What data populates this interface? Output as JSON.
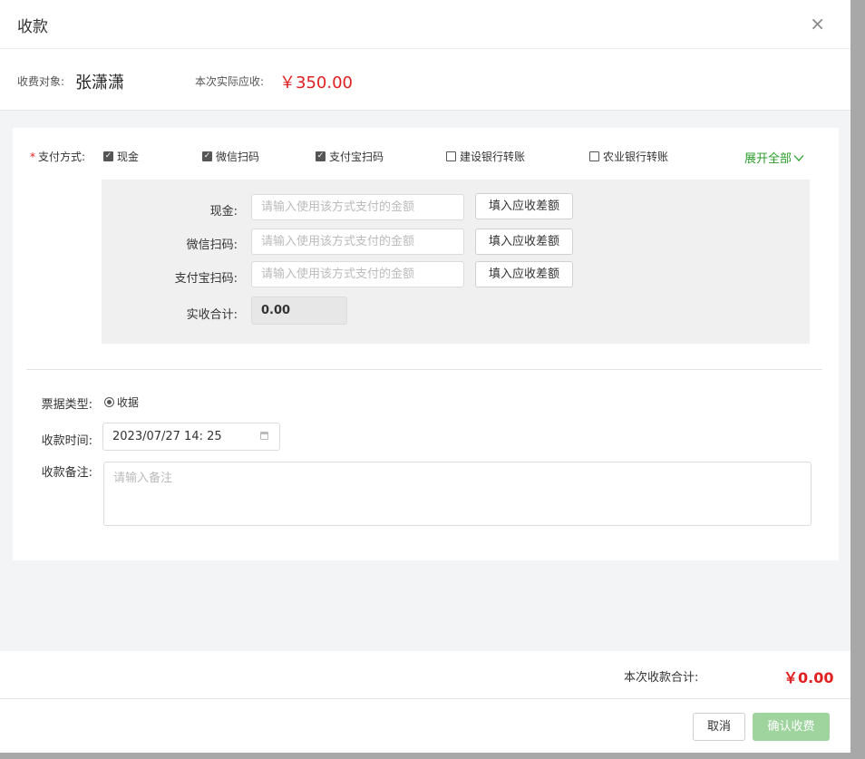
{
  "dialog": {
    "title": "收款",
    "close_glyph": "×"
  },
  "info": {
    "payer_label": "收费对象:",
    "payer_name": "张潇潇",
    "due_label": "本次实际应收:",
    "due_amount": "￥350.00"
  },
  "payment": {
    "label": "支付方式:",
    "required_mark": "*",
    "methods": [
      {
        "label": "现金",
        "checked": true
      },
      {
        "label": "微信扫码",
        "checked": true
      },
      {
        "label": "支付宝扫码",
        "checked": true
      },
      {
        "label": "建设银行转账",
        "checked": false
      },
      {
        "label": "农业银行转账",
        "checked": false
      }
    ],
    "expand_label": "展开全部",
    "expand_icon": "chevron-down-icon",
    "rows": [
      {
        "label": "现金:",
        "placeholder": "请输入使用该方式支付的金额",
        "fill_button": "填入应收差额"
      },
      {
        "label": "微信扫码:",
        "placeholder": "请输入使用该方式支付的金额",
        "fill_button": "填入应收差额"
      },
      {
        "label": "支付宝扫码:",
        "placeholder": "请输入使用该方式支付的金额",
        "fill_button": "填入应收差额"
      }
    ],
    "total_label": "实收合计:",
    "total_value": "0.00"
  },
  "form": {
    "receipt_type_label": "票据类型:",
    "receipt_type_option": "收据",
    "time_label": "收款时间:",
    "time_value": "2023/07/27  14: 25",
    "remark_label": "收款备注:",
    "remark_placeholder": "请输入备注"
  },
  "summary": {
    "label": "本次收款合计:",
    "value": "￥0.00"
  },
  "footer": {
    "cancel_label": "取消",
    "confirm_label": "确认收费"
  },
  "colors": {
    "accent_red": "#e02020",
    "accent_green": "#2a9d2a",
    "confirm_button": "#9fd49f"
  }
}
